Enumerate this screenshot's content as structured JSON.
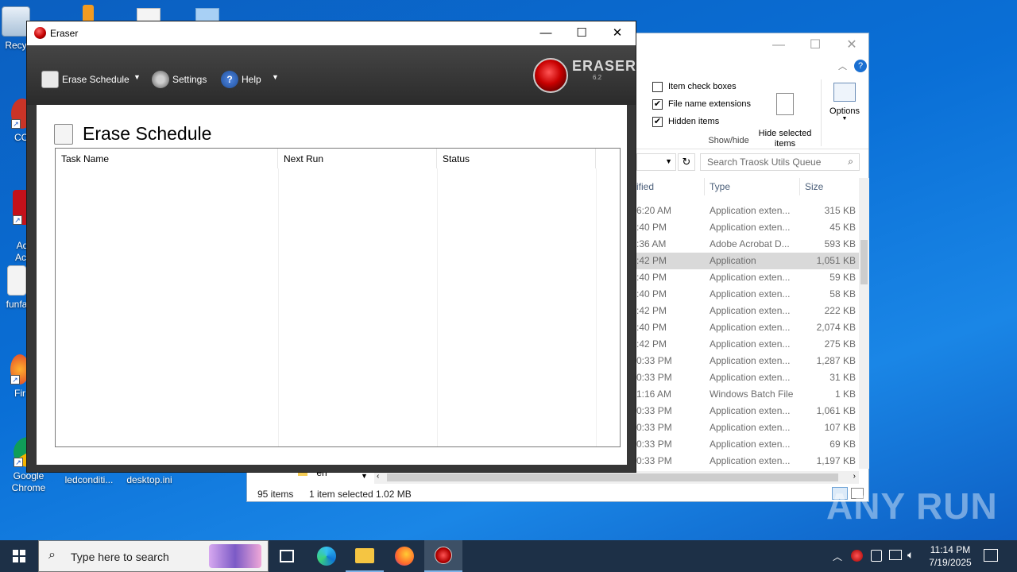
{
  "desktop": {
    "icons": [
      {
        "label": "Recy"
      },
      {
        "label": "CCl"
      },
      {
        "label": "Ad\nAcr"
      },
      {
        "label": "funfa"
      },
      {
        "label": "Fir"
      },
      {
        "label": "Google Chrome"
      },
      {
        "label": "ledconditi..."
      },
      {
        "label": "desktop.ini"
      }
    ]
  },
  "explorer": {
    "ribbon": {
      "item_check_boxes": "Item check boxes",
      "file_name_extensions": "File name extensions",
      "hidden_items": "Hidden items",
      "hide_selected": "Hide selected\nitems",
      "options": "Options",
      "group_label": "Show/hide"
    },
    "search_placeholder": "Search Traosk Utils Queue",
    "columns": {
      "modified": "ified",
      "type": "Type",
      "size": "Size"
    },
    "rows": [
      {
        "date": "6:20 AM",
        "type": "Application exten...",
        "size": "315 KB"
      },
      {
        "date": ":40 PM",
        "type": "Application exten...",
        "size": "45 KB"
      },
      {
        "date": ":36 AM",
        "type": "Adobe Acrobat D...",
        "size": "593 KB"
      },
      {
        "date": ":42 PM",
        "type": "Application",
        "size": "1,051 KB",
        "selected": true
      },
      {
        "date": ":40 PM",
        "type": "Application exten...",
        "size": "59 KB"
      },
      {
        "date": ":40 PM",
        "type": "Application exten...",
        "size": "58 KB"
      },
      {
        "date": ":42 PM",
        "type": "Application exten...",
        "size": "222 KB"
      },
      {
        "date": ":40 PM",
        "type": "Application exten...",
        "size": "2,074 KB"
      },
      {
        "date": ":42 PM",
        "type": "Application exten...",
        "size": "275 KB"
      },
      {
        "date": "0:33 PM",
        "type": "Application exten...",
        "size": "1,287 KB"
      },
      {
        "date": "0:33 PM",
        "type": "Application exten...",
        "size": "31 KB"
      },
      {
        "date": "1:16 AM",
        "type": "Windows Batch File",
        "size": "1 KB"
      },
      {
        "date": "0:33 PM",
        "type": "Application exten...",
        "size": "1,061 KB"
      },
      {
        "date": "0:33 PM",
        "type": "Application exten...",
        "size": "107 KB"
      },
      {
        "date": "0:33 PM",
        "type": "Application exten...",
        "size": "69 KB"
      },
      {
        "date": "0:33 PM",
        "type": "Application exten...",
        "size": "1,197 KB"
      }
    ],
    "tree_item": "en",
    "status": {
      "items": "95 items",
      "selected": "1 item selected  1.02 MB"
    }
  },
  "eraser": {
    "title": "Eraser",
    "toolbar": {
      "erase_schedule": "Erase Schedule",
      "settings": "Settings",
      "help": "Help"
    },
    "logo": {
      "text": "ERASER",
      "version": "6.2"
    },
    "panel_title": "Erase Schedule",
    "table_headers": [
      "Task Name",
      "Next Run",
      "Status"
    ]
  },
  "taskbar": {
    "search_placeholder": "Type here to search",
    "time": "11:14 PM",
    "date": "7/19/2025"
  },
  "watermark": "ANY RUN"
}
